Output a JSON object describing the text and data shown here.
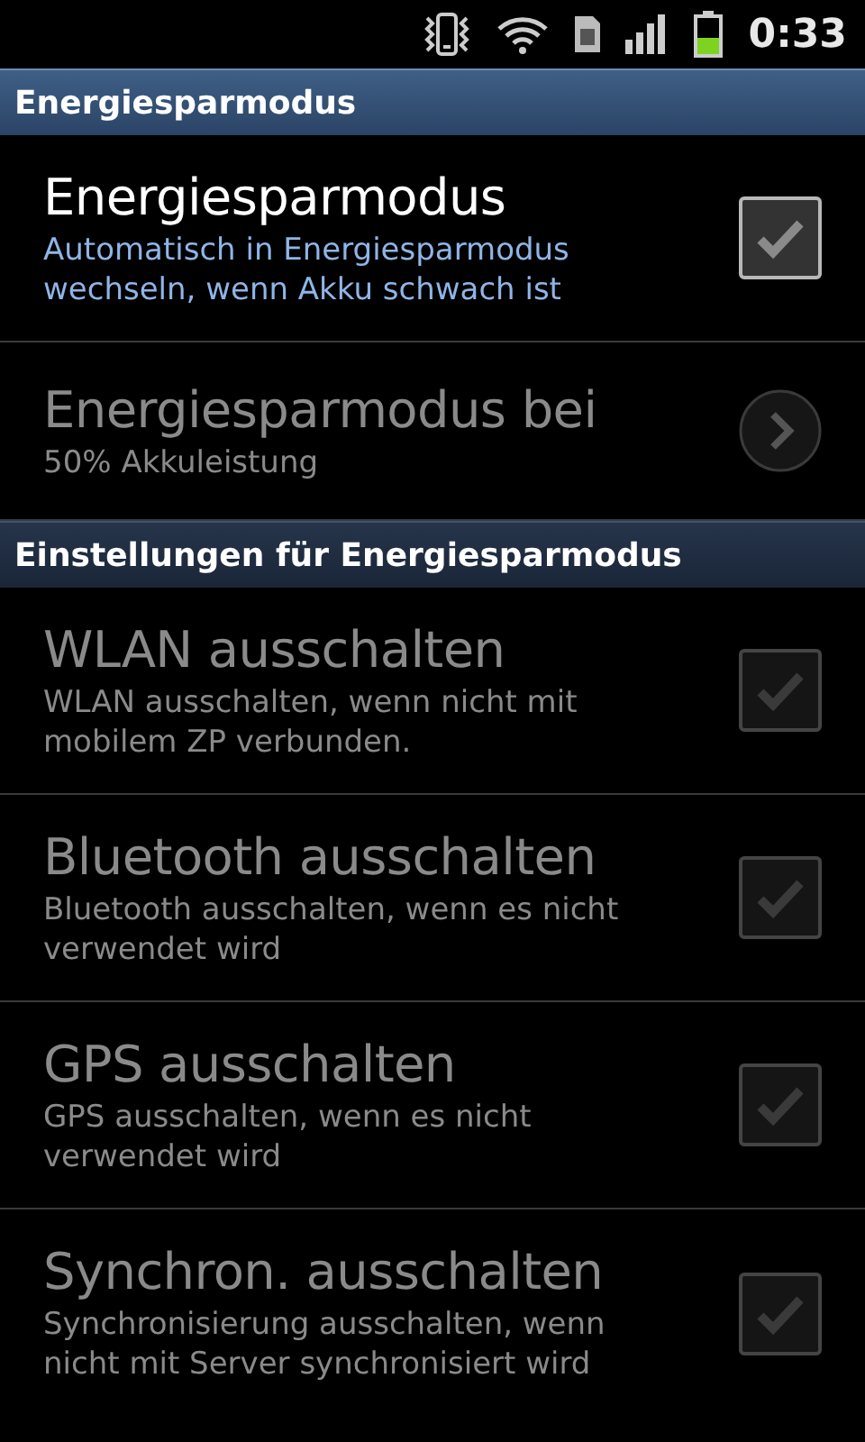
{
  "status_bar": {
    "time": "0:33"
  },
  "sections": [
    {
      "title": "Energiesparmodus",
      "items": [
        {
          "kind": "checkbox",
          "title": "Energiesparmodus",
          "summary": "Automatisch in Energiesparmodus wechseln, wenn Akku schwach ist",
          "disabled": false,
          "checked": false
        },
        {
          "kind": "arrow",
          "title": "Energiesparmodus bei",
          "summary": "50% Akkuleistung",
          "disabled": true
        }
      ]
    },
    {
      "title": "Einstellungen für Energiesparmodus",
      "items": [
        {
          "kind": "checkbox",
          "title": "WLAN ausschalten",
          "summary": "WLAN ausschalten, wenn nicht mit mobilem ZP verbunden.",
          "disabled": true,
          "checked": false
        },
        {
          "kind": "checkbox",
          "title": "Bluetooth ausschalten",
          "summary": "Bluetooth ausschalten, wenn es nicht verwendet wird",
          "disabled": true,
          "checked": false
        },
        {
          "kind": "checkbox",
          "title": "GPS ausschalten",
          "summary": "GPS ausschalten, wenn es nicht verwendet wird",
          "disabled": true,
          "checked": false
        },
        {
          "kind": "checkbox",
          "title": "Synchron. ausschalten",
          "summary": "Synchronisierung ausschalten, wenn nicht mit Server synchronisiert wird",
          "disabled": true,
          "checked": false
        }
      ]
    }
  ]
}
